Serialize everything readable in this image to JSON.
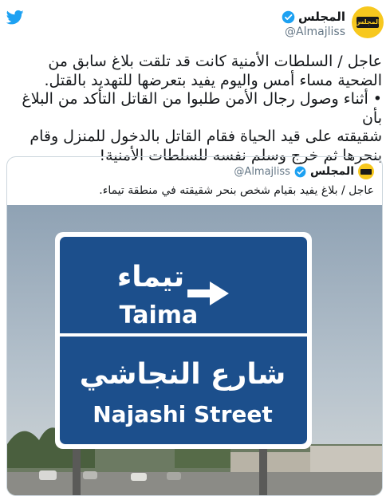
{
  "tweet": {
    "author_name": "المجلس",
    "author_handle": "@Almajliss",
    "avatar_logo_text": "المجلس",
    "body_lines": [
      "عاجل / السلطات الأمنية كانت قد تلقت بلاغ سابق من",
      "الضحية مساء أمس واليوم يفيد بتعرضها للتهديد بالقتل.",
      "• أثناء وصول رجال الأمن طلبوا من القاتل التأكد من البلاغ بأن",
      "شقيقته على قيد الحياة فقام القاتل بالدخول للمنزل وقام",
      "بنحرها ثم خرج وسلم نفسه للسلطات الأمنية!"
    ]
  },
  "quoted": {
    "author_name": "المجلس",
    "author_handle": "@Almajliss",
    "text": "عاجل / بلاغ يفيد بقيام شخص بنحر شقيقته في منطقة تيماء.",
    "image": {
      "sign_arabic_city": "تيماء",
      "sign_english_city": "Taima",
      "sign_arabic_street": "شارع النجاشي",
      "sign_english_street": "Najashi Street"
    }
  },
  "colors": {
    "twitter_blue": "#1da1f2",
    "brand_yellow": "#f7c81e",
    "sign_blue": "#1c4f8c"
  },
  "icons": [
    "twitter-bird-icon",
    "verified-badge-icon",
    "right-arrow-icon"
  ]
}
